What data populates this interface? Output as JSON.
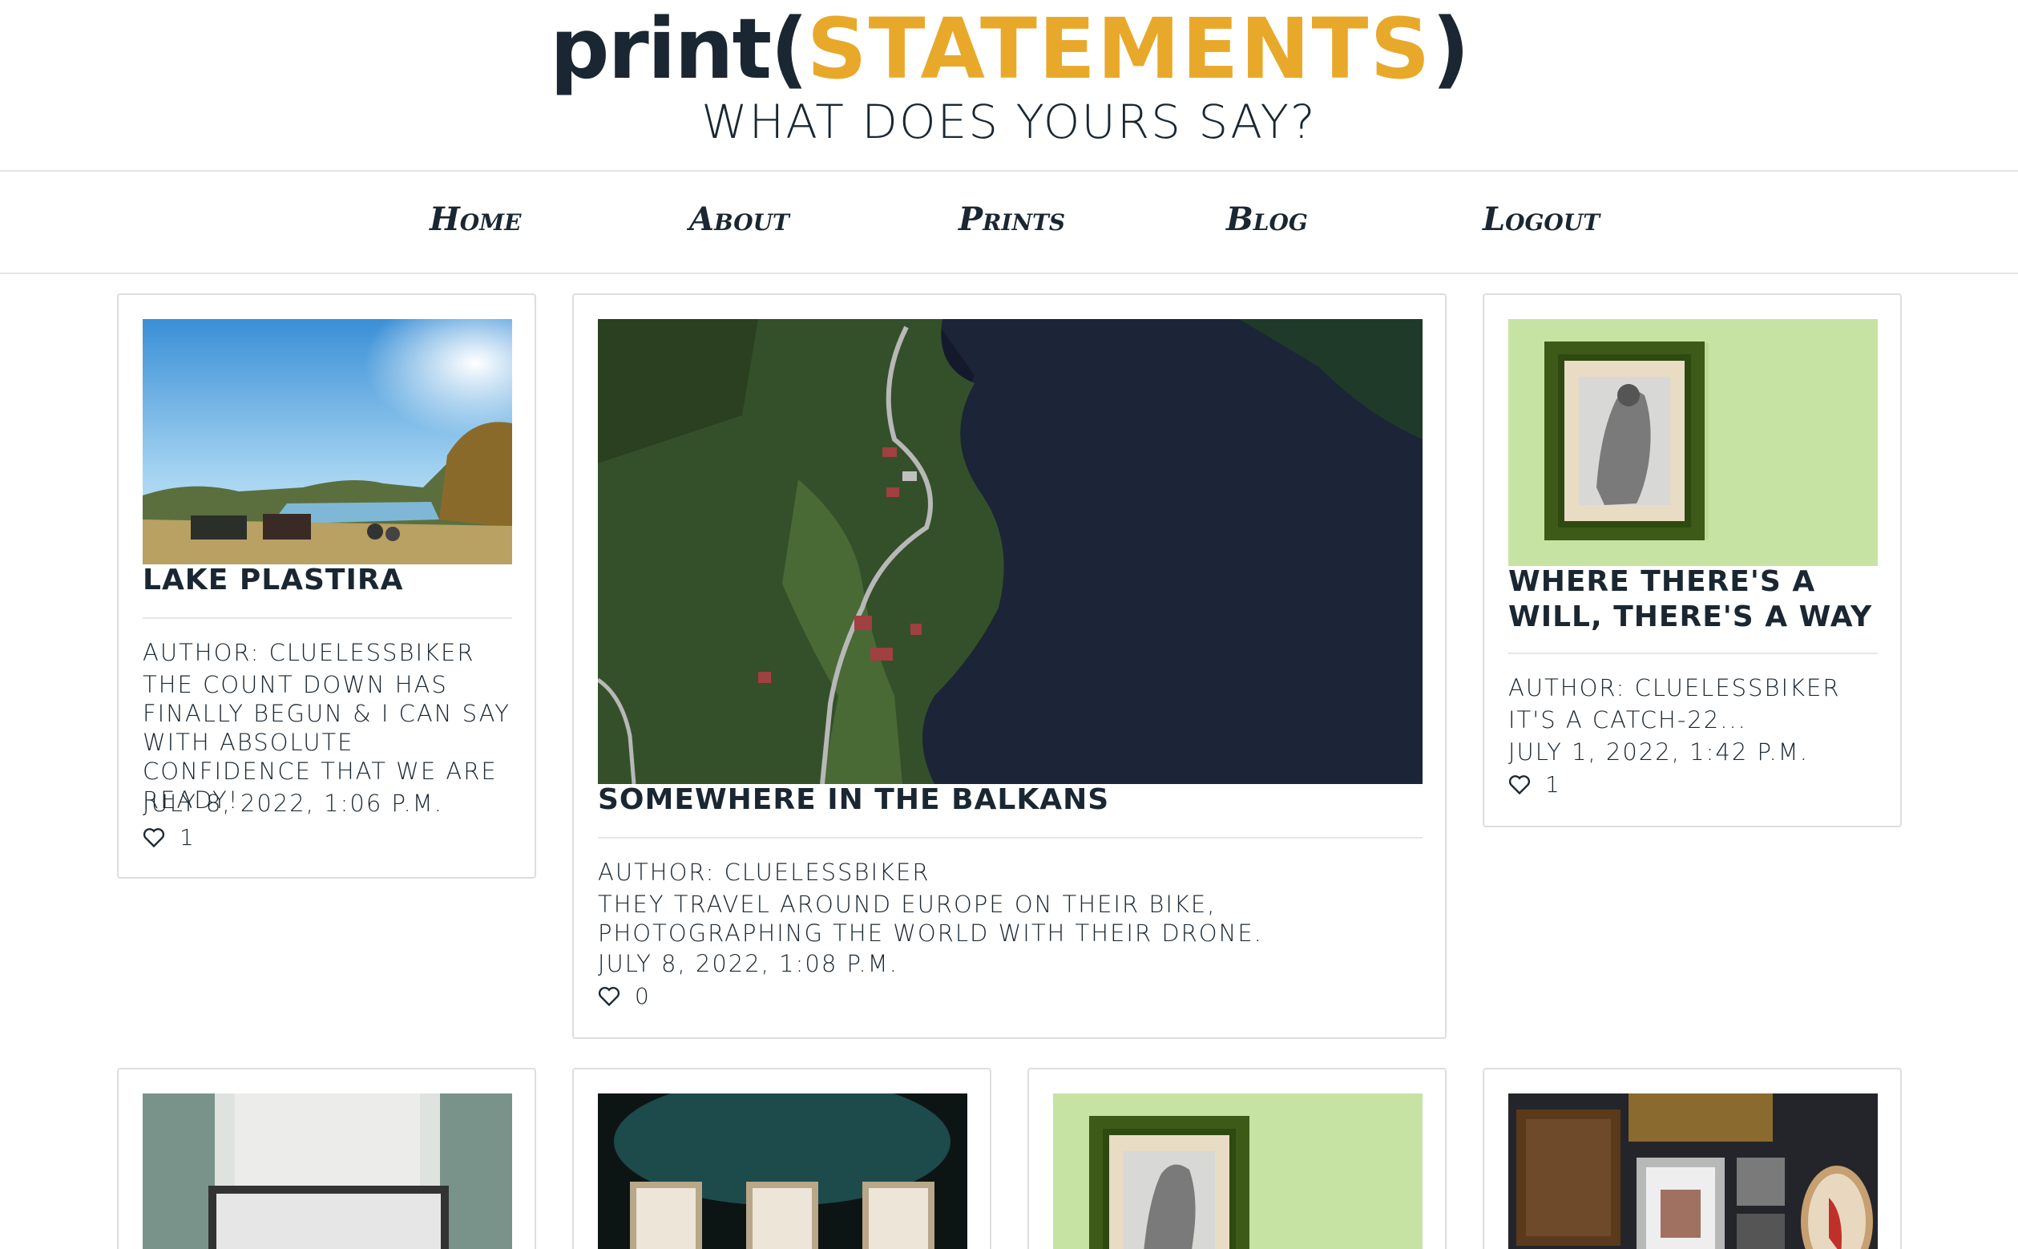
{
  "header": {
    "brand_prefix": "print(",
    "brand_accent": "STATEMENTS",
    "brand_suffix": ")",
    "tagline": "WHAT DOES YOURS SAY?"
  },
  "nav": [
    "Home",
    "About",
    "Prints",
    "Blog",
    "Logout"
  ],
  "posts": [
    {
      "title": "LAKE PLASTIRA",
      "author": "AUTHOR: CLUELESSBIKER",
      "excerpt": "THE COUNT DOWN HAS FINALLY BEGUN & I CAN SAY WITH ABSOLUTE CONFIDENCE THAT WE ARE READY!",
      "date": "JULY 8, 2022, 1:06 P.M.",
      "likes": "1"
    },
    {
      "title": "SOMEWHERE IN THE BALKANS",
      "author": "AUTHOR: CLUELESSBIKER",
      "excerpt": "THEY TRAVEL AROUND EUROPE ON THEIR BIKE, PHOTOGRAPHING THE WORLD WITH THEIR DRONE.",
      "date": "JULY 8, 2022, 1:08 P.M.",
      "likes": "0"
    },
    {
      "title": "WHERE THERE'S A WILL, THERE'S A WAY",
      "author": "AUTHOR: CLUELESSBIKER",
      "excerpt": "IT'S A CATCH-22...",
      "date": "JULY 1, 2022, 1:42 P.M.",
      "likes": "1"
    }
  ],
  "colors": {
    "brand_dark": "#1a2732",
    "brand_accent": "#e8a92b"
  }
}
